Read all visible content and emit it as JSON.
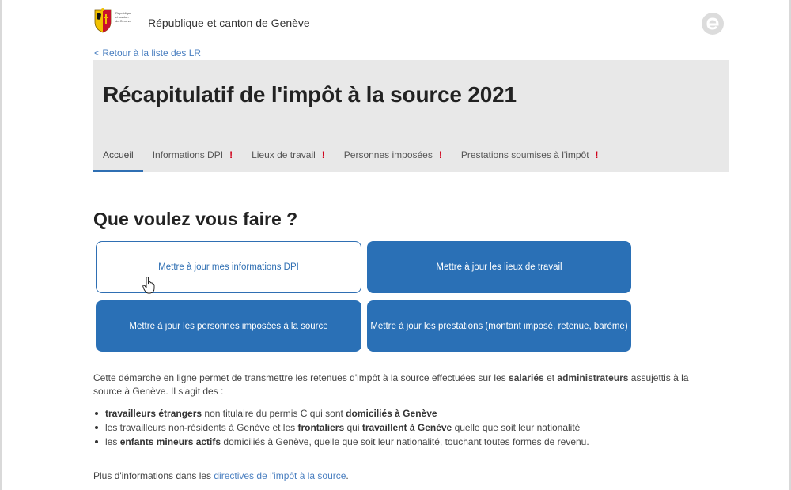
{
  "header": {
    "crest_text": "République et canton de Genève",
    "site_name": "République et canton de Genève",
    "logo_icon": "e-logo-icon"
  },
  "nav": {
    "back_link": "< Retour à la liste des LR"
  },
  "banner": {
    "title": "Récapitulatif de l'impôt à la source 2021",
    "tabs": [
      {
        "label": "Accueil",
        "warning": "",
        "active": true
      },
      {
        "label": "Informations DPI",
        "warning": "!"
      },
      {
        "label": "Lieux de travail",
        "warning": "!"
      },
      {
        "label": "Personnes imposées",
        "warning": "!"
      },
      {
        "label": "Prestations soumises à l'impôt",
        "warning": "!"
      }
    ]
  },
  "main": {
    "title": "Que voulez vous faire ?",
    "actions": [
      "Mettre à jour mes informations DPI",
      "Mettre à jour les lieux de travail",
      "Mettre à jour les personnes imposées à la source",
      "Mettre à jour les prestations (montant imposé, retenue, barème)"
    ],
    "intro": {
      "part1": "Cette démarche en ligne permet de transmettre les retenues d'impôt à la source effectuées sur les ",
      "bold1": "salariés",
      "part2": " et ",
      "bold2": "administrateurs",
      "part3": " assujettis à la source à Genève. Il s'agit des :"
    },
    "bullets": [
      {
        "b1": "travailleurs étrangers",
        "t1": " non titulaire du permis C qui sont ",
        "b2": "domiciliés à Genève",
        "t2": ""
      },
      {
        "t0": "les travailleurs non-résidents à Genève et les ",
        "b1": "frontaliers",
        "t1": " qui ",
        "b2": "travaillent à Genève",
        "t2": " quelle que soit leur nationalité"
      },
      {
        "t0": "les ",
        "b1": "enfants mineurs actifs",
        "t1": " domiciliés à Genève, quelle que soit leur nationalité, touchant toutes formes de revenu.",
        "b2": "",
        "t2": ""
      }
    ],
    "more_prefix": "Plus d'informations dans les ",
    "more_link": "directives de l'impôt à la source",
    "more_suffix": "."
  },
  "colors": {
    "accent": "#2a70b6",
    "warning": "#d0021b",
    "banner_bg": "#e8e8e8",
    "link": "#4a7fc0"
  }
}
